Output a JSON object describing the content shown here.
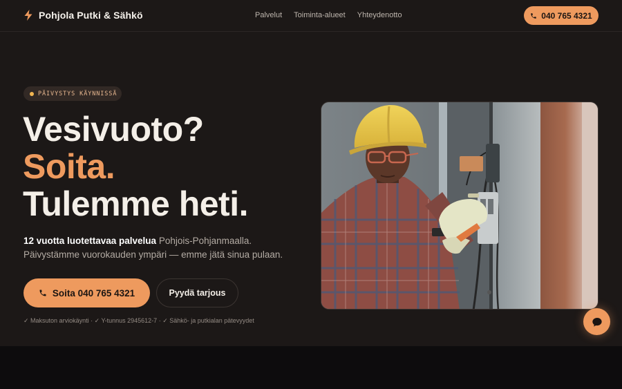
{
  "header": {
    "brand_name": "Pohjola Putki & Sähkö",
    "brand_icon": "bolt-icon",
    "nav": [
      "Palvelut",
      "Toiminta-alueet",
      "Yhteydenotto"
    ],
    "cta_label": "040 765 4321",
    "cta_icon": "phone-icon"
  },
  "hero": {
    "badge": "PÄIVYSTYS KÄYNNISSÄ",
    "headline_line1": "Vesivuoto?",
    "headline_line2": "Soita.",
    "headline_line3": "Tulemme heti.",
    "lead_strong": "12 vuotta luotettavaa palvelua",
    "lead_rest": " Pohjois-Pohjanmaalla. Päivystämme vuorokauden ympäri — emme jätä sinua pulaan.",
    "primary_cta": "Soita 040 765 4321",
    "secondary_cta": "Pyydä tarjous",
    "trust_line": "✓ Maksuton arviokäynti · ✓ Y-tunnus 2945612-7 · ✓ Sähkö- ja putkialan pätevyydet"
  },
  "chat": {
    "icon": "chat-bubble-icon"
  },
  "colors": {
    "background": "#1c1817",
    "accent": "#ee9a5e",
    "badge_dot": "#f2b651",
    "next_section": "#0d0c0d"
  }
}
